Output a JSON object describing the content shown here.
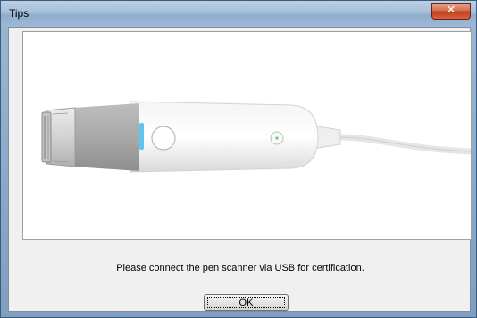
{
  "window": {
    "title": "Tips",
    "close_icon": "close-icon"
  },
  "dialog": {
    "message": "Please connect the pen scanner via USB for certification.",
    "ok_label": "OK"
  },
  "image": {
    "subject": "pen-scanner-illustration",
    "accent_color": "#5fc4ee",
    "led_color": "#5ed46a"
  }
}
